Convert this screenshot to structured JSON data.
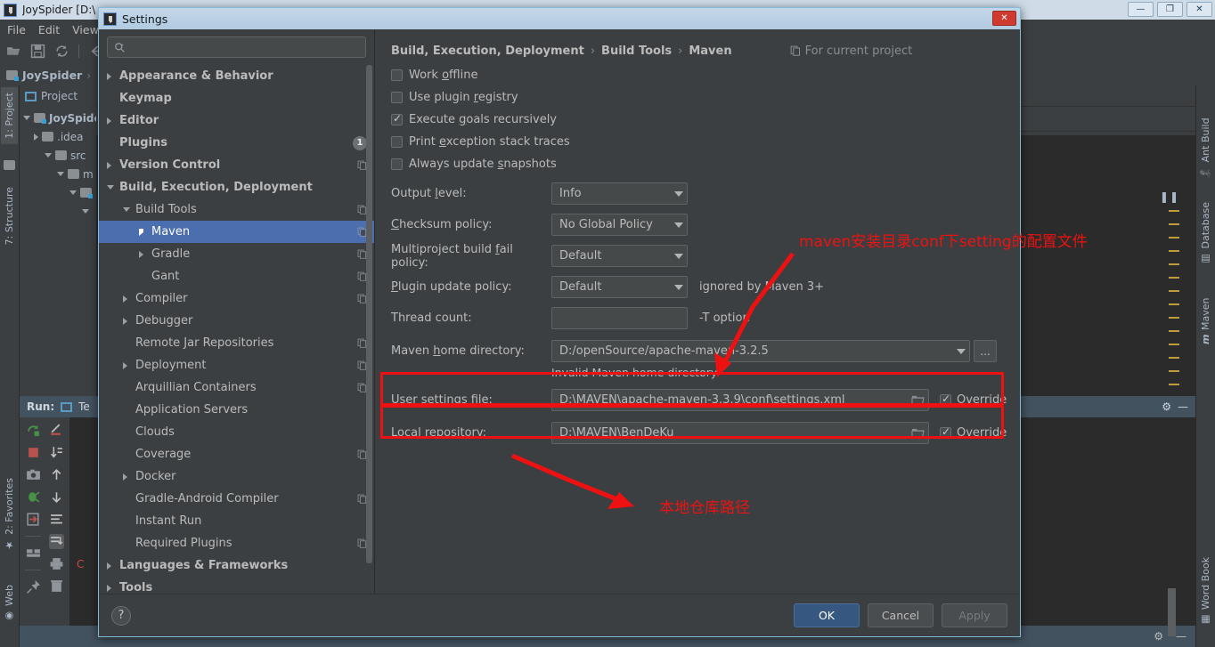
{
  "ide": {
    "title": "JoySpider [D:\\",
    "menu": [
      "File",
      "Edit",
      "View"
    ],
    "navbar": {
      "project": "JoySpider",
      "sep": "›"
    },
    "left_tabs": [
      {
        "label": "1: Project",
        "icon": "project-icon"
      },
      {
        "label": "7: Structure",
        "icon": "structure-icon"
      },
      {
        "label": "2: Favorites",
        "icon": "star-icon"
      },
      {
        "label": "Web",
        "icon": "web-icon"
      }
    ],
    "right_tabs": [
      {
        "label": "Ant Build",
        "icon": "ant-icon"
      },
      {
        "label": "Database",
        "icon": "database-icon"
      },
      {
        "label": "Maven",
        "icon": "maven-icon"
      },
      {
        "label": "Word Book",
        "icon": "book-icon"
      }
    ],
    "project_panel": {
      "header": "Project",
      "tree": [
        {
          "label": "JoySpide",
          "level": 0,
          "state": "expanded",
          "icon": "module-icon"
        },
        {
          "label": ".idea",
          "level": 1,
          "state": "collapsed",
          "icon": "folder-icon"
        },
        {
          "label": "src",
          "level": 1,
          "state": "expanded",
          "icon": "folder-icon"
        },
        {
          "label": "m",
          "level": 2,
          "state": "expanded",
          "icon": "folder-icon"
        },
        {
          "label": "",
          "level": 3,
          "state": "expanded",
          "icon": "folder-icon"
        }
      ]
    },
    "run_panel": {
      "label": "Run:",
      "tab": "Te"
    },
    "console_text": "C",
    "window_buttons": {
      "minimize": "—",
      "maximize": "❐",
      "close": "✕"
    }
  },
  "dialog": {
    "title": "Settings",
    "close_label": "✕",
    "search": {
      "value": "",
      "placeholder": ""
    },
    "tree": [
      {
        "label": "Appearance & Behavior",
        "level": 0,
        "arrow": "right",
        "bold": true
      },
      {
        "label": "Keymap",
        "level": 0,
        "arrow": "none",
        "bold": true
      },
      {
        "label": "Editor",
        "level": 0,
        "arrow": "right",
        "bold": true
      },
      {
        "label": "Plugins",
        "level": 0,
        "arrow": "none",
        "bold": true,
        "badge": "1"
      },
      {
        "label": "Version Control",
        "level": 0,
        "arrow": "right",
        "bold": true,
        "copy": true
      },
      {
        "label": "Build, Execution, Deployment",
        "level": 0,
        "arrow": "down",
        "bold": true
      },
      {
        "label": "Build Tools",
        "level": 1,
        "arrow": "down",
        "copy": true
      },
      {
        "label": "Maven",
        "level": 2,
        "arrow": "right",
        "copy": true,
        "selected": true
      },
      {
        "label": "Gradle",
        "level": 2,
        "arrow": "right",
        "copy": true
      },
      {
        "label": "Gant",
        "level": 2,
        "arrow": "none",
        "copy": true
      },
      {
        "label": "Compiler",
        "level": 1,
        "arrow": "right",
        "copy": true
      },
      {
        "label": "Debugger",
        "level": 1,
        "arrow": "right"
      },
      {
        "label": "Remote Jar Repositories",
        "level": 1,
        "arrow": "none",
        "copy": true
      },
      {
        "label": "Deployment",
        "level": 1,
        "arrow": "right",
        "copy": true
      },
      {
        "label": "Arquillian Containers",
        "level": 1,
        "arrow": "none",
        "copy": true
      },
      {
        "label": "Application Servers",
        "level": 1,
        "arrow": "none"
      },
      {
        "label": "Clouds",
        "level": 1,
        "arrow": "none"
      },
      {
        "label": "Coverage",
        "level": 1,
        "arrow": "none",
        "copy": true
      },
      {
        "label": "Docker",
        "level": 1,
        "arrow": "right"
      },
      {
        "label": "Gradle-Android Compiler",
        "level": 1,
        "arrow": "none",
        "copy": true
      },
      {
        "label": "Instant Run",
        "level": 1,
        "arrow": "none"
      },
      {
        "label": "Required Plugins",
        "level": 1,
        "arrow": "none",
        "copy": true
      },
      {
        "label": "Languages & Frameworks",
        "level": 0,
        "arrow": "right",
        "bold": true
      },
      {
        "label": "Tools",
        "level": 0,
        "arrow": "right",
        "bold": true
      }
    ],
    "breadcrumb": {
      "part1": "Build, Execution, Deployment",
      "part2": "Build Tools",
      "part3": "Maven",
      "separator": "›",
      "scope": "For current project"
    },
    "checkboxes": [
      {
        "label": "Work offline",
        "mnemonic": "o",
        "checked": false
      },
      {
        "label": "Use plugin registry",
        "mnemonic": "r",
        "checked": false
      },
      {
        "label": "Execute goals recursively",
        "mnemonic": "g",
        "checked": true
      },
      {
        "label": "Print exception stack traces",
        "mnemonic": "e",
        "checked": false
      },
      {
        "label": "Always update snapshots",
        "mnemonic": "s",
        "checked": false
      }
    ],
    "fields": [
      {
        "label": "Output level:",
        "mnemonic": "l",
        "type": "combo",
        "value": "Info",
        "hint": ""
      },
      {
        "label": "Checksum policy:",
        "mnemonic": "C",
        "type": "combo",
        "value": "No Global Policy",
        "hint": ""
      },
      {
        "label": "Multiproject build fail policy:",
        "mnemonic": "f",
        "type": "combo",
        "value": "Default",
        "hint": ""
      },
      {
        "label": "Plugin update policy:",
        "mnemonic": "P",
        "type": "combo",
        "value": "Default",
        "hint": "ignored by Maven 3+"
      },
      {
        "label": "Thread count:",
        "mnemonic": "",
        "type": "text",
        "value": "",
        "hint": "-T option"
      }
    ],
    "maven_home": {
      "label": "Maven home directory:",
      "mnemonic": "h",
      "value": "D:/openSource/apache-maven-3.2.5",
      "browse_label": "...",
      "error": "Invalid Maven home directory"
    },
    "user_settings": {
      "label": "User settings file:",
      "mnemonic": "s",
      "value": "D:\\MAVEN\\apache-maven-3.3.9\\conf\\settings.xml",
      "override_label": "Override",
      "override_checked": true
    },
    "local_repository": {
      "label": "Local repository:",
      "mnemonic": "r",
      "value": "D:\\MAVEN\\BenDeKu",
      "override_label": "Override",
      "override_checked": true
    },
    "annotations": [
      {
        "text": "maven安装目录conf下setting的配置文件",
        "color": "#ee1111"
      },
      {
        "text": "本地仓库路径",
        "color": "#ee1111"
      }
    ],
    "footer": {
      "help": "?",
      "ok": "OK",
      "cancel": "Cancel",
      "apply": "Apply"
    }
  },
  "colors": {
    "accent_selection": "#4b6eaf",
    "dialog_bg": "#3c3f41",
    "primary_button": "#365880",
    "annotation_red": "#ee1111",
    "titlebar": "#c3d7e8"
  }
}
